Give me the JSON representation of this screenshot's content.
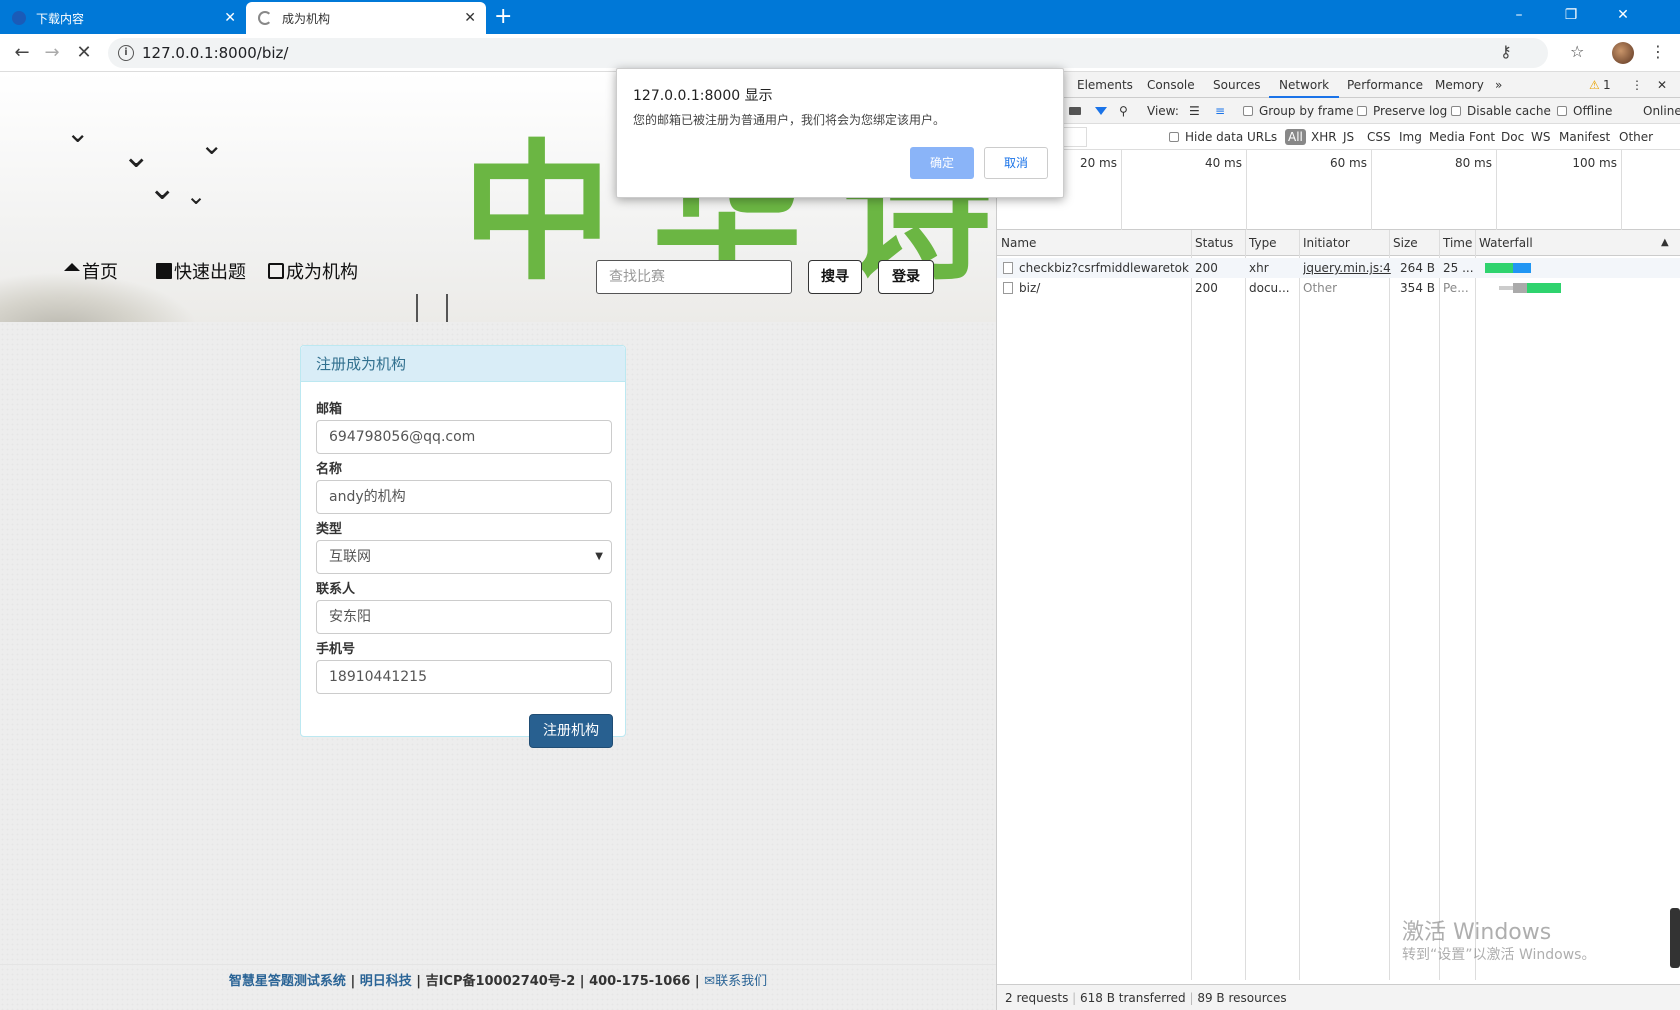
{
  "browser": {
    "tabs": [
      {
        "title": "下载内容",
        "state": "inactive"
      },
      {
        "title": "成为机构",
        "state": "active-loading"
      }
    ],
    "new_tab": "+",
    "url": "127.0.0.1:8000/biz/",
    "window_controls": [
      "–",
      "❐",
      "✕"
    ]
  },
  "page": {
    "banner_title": "中华诗词",
    "nav": [
      {
        "label": "首页",
        "icon": "home-icon"
      },
      {
        "label": "快速出题",
        "icon": "book-icon"
      },
      {
        "label": "成为机构",
        "icon": "check-square-icon"
      }
    ],
    "search": {
      "placeholder": "查找比赛"
    },
    "search_button": "搜寻",
    "login_button": "登录",
    "form": {
      "title": "注册成为机构",
      "fields": [
        {
          "label": "邮箱",
          "value": "694798056@qq.com"
        },
        {
          "label": "名称",
          "value": "andy的机构"
        },
        {
          "label": "类型",
          "value": "互联网"
        },
        {
          "label": "联系人",
          "value": "安东阳"
        },
        {
          "label": "手机号",
          "value": "18910441215"
        }
      ],
      "submit": "注册机构"
    },
    "footer": {
      "system": "智慧星答题测试系统",
      "sep": " | ",
      "company": "明日科技",
      "icp": "吉ICP备10002740号-2",
      "phone": "400-175-1066",
      "contact": "联系我们"
    }
  },
  "dialog": {
    "title": "127.0.0.1:8000 显示",
    "message": "您的邮箱已被注册为普通用户，我们将会为您绑定该用户。",
    "ok": "确定",
    "cancel": "取消"
  },
  "devtools": {
    "tabs": [
      "Elements",
      "Console",
      "Sources",
      "Network",
      "Performance",
      "Memory",
      "»"
    ],
    "selected_tab": "Network",
    "warnings": "1",
    "toolbar": {
      "view_label": "View:",
      "group_by_frame": "Group by frame",
      "preserve_log": "Preserve log",
      "disable_cache": "Disable cache",
      "offline": "Offline",
      "online": "Online"
    },
    "filters": {
      "hide_data_urls": "Hide data URLs",
      "types": [
        "All",
        "XHR",
        "JS",
        "CSS",
        "Img",
        "Media",
        "Font",
        "Doc",
        "WS",
        "Manifest",
        "Other"
      ]
    },
    "overview_ticks": [
      "20 ms",
      "40 ms",
      "60 ms",
      "80 ms",
      "100 ms"
    ],
    "columns": [
      "Name",
      "Status",
      "Type",
      "Initiator",
      "Size",
      "Time",
      "Waterfall"
    ],
    "rows": [
      {
        "name": "checkbiz?csrfmiddlewaretoke...",
        "status": "200",
        "type": "xhr",
        "initiator": "jquery.min.js:4",
        "size": "264 B",
        "time": "25 ..."
      },
      {
        "name": "biz/",
        "status": "200",
        "type": "docu...",
        "initiator": "Other",
        "size": "354 B",
        "time": "Pe..."
      }
    ],
    "status": {
      "requests": "2 requests",
      "transferred": "618 B transferred",
      "resources": "89 B resources"
    }
  },
  "watermark": {
    "line1": "激活 Windows",
    "line2": "转到“设置”以激活 Windows。"
  },
  "colors": {
    "tabbar": "#0078d7",
    "banner_title": "#6bb643",
    "primary_button": "#286090",
    "panel_head": "#d9edf7",
    "dialog_ok": "#8ab4f8"
  }
}
